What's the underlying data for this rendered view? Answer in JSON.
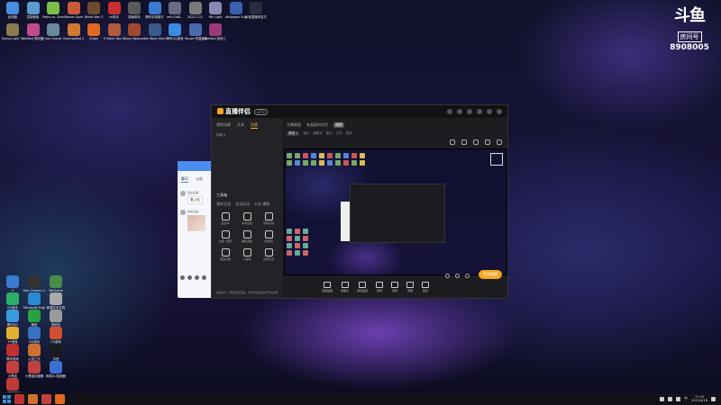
{
  "desktop": {
    "icons_top": [
      {
        "label": "此电脑",
        "color": "#4a8de0"
      },
      {
        "label": "控制面板",
        "color": "#5a9ad0"
      },
      {
        "label": "Paths vs. Zombies",
        "color": "#7bbf4a"
      },
      {
        "label": "Mouse Gaze",
        "color": "#c85a3a"
      },
      {
        "label": "World War Z",
        "color": "#6b4a30"
      },
      {
        "label": "vn助手",
        "color": "#c83030"
      },
      {
        "label": "原画助手",
        "color": "#5a5a5a"
      },
      {
        "label": "腾讯手游助手",
        "color": "#3a7ad0"
      },
      {
        "label": "neil-GoBi...",
        "color": "#6a6a80"
      },
      {
        "label": "2022.2.22",
        "color": "#7a7a7a"
      },
      {
        "label": "Wa Light",
        "color": "#8a8ab0"
      },
      {
        "label": "Wallpaper Engine",
        "color": "#3a60b0"
      },
      {
        "label": "抖音直播伴侣平台",
        "color": "#2a2a40"
      }
    ],
    "icons_row2": [
      {
        "label": "Dying Light The Follo...",
        "color": "#8a7a50"
      },
      {
        "label": "WeMod 修改器游戏工具",
        "color": "#c04a8a"
      },
      {
        "label": "Iron Gravel",
        "color": "#6a8a9a"
      },
      {
        "label": "Overcooked 2",
        "color": "#d07a30"
      },
      {
        "label": "Origin",
        "color": "#e06a20"
      },
      {
        "label": "It Takes Two Fr...",
        "color": "#b05a40"
      },
      {
        "label": "Ivory Beacon",
        "color": "#a04a30"
      },
      {
        "label": "We Were Here Toge...",
        "color": "#3a5a8a"
      },
      {
        "label": "腾讯QQ游戏",
        "color": "#3a8ae0"
      },
      {
        "label": "Mouse 有直播伴侣",
        "color": "#4a6ab0"
      },
      {
        "label": "WeMod 游戏工具",
        "color": "#9a3a7a"
      }
    ],
    "icons_left": [
      {
        "label": "V",
        "color": "#3a7ad0"
      },
      {
        "label": "Epic Games Launcher",
        "color": "#333333"
      },
      {
        "label": "WeGame",
        "color": "#4a8a4a"
      },
      {
        "label": "QQ音乐",
        "color": "#2ab06a"
      },
      {
        "label": "Microsoft Edge",
        "color": "#2a8ad0"
      },
      {
        "label": "新建文本文档",
        "color": "#aaaaaa"
      },
      {
        "label": "腾讯QQ",
        "color": "#3a9ae0"
      },
      {
        "label": "微信",
        "color": "#2aa040"
      },
      {
        "label": "回收站",
        "color": "#9a9a9a"
      },
      {
        "label": "YY语音",
        "color": "#e0b030"
      },
      {
        "label": "QQ游戏",
        "color": "#3a70c0"
      },
      {
        "label": "CS游戏",
        "color": "#d05030"
      },
      {
        "label": "腾讯游戏",
        "color": "#c03030"
      },
      {
        "label": "火炬之光",
        "color": "#d07030"
      },
      {
        "label": "抖音",
        "color": "#1a1a1a"
      },
      {
        "label": "小黑盒",
        "color": "#c04040"
      },
      {
        "label": "小黑盒加速器",
        "color": "#c04040"
      },
      {
        "label": "网易UU加速器",
        "color": "#3a70d0"
      },
      {
        "label": "小黑盒游戏",
        "color": "#c03a3a"
      }
    ]
  },
  "logo_badge": {
    "mark": "斗鱼",
    "sub": "房间号",
    "room_number": "8908005"
  },
  "chat": {
    "tabs": [
      "聊天",
      "公告"
    ],
    "messages": [
      {
        "name": "某某主播",
        "text": "要上线"
      },
      {
        "name": "某某主播",
        "text": ""
      }
    ]
  },
  "app": {
    "brand": "直播伴侣",
    "version": "v7.0",
    "left_tabs": [
      "我的场景",
      "开关",
      "场景"
    ],
    "scene_row": "场景 1",
    "tools_title": "工具箱",
    "tool_groups": [
      "我的互动",
      "互动玩法",
      "公告·通知"
    ],
    "tools": [
      {
        "label": "连麦PK",
        "icon": "link-icon"
      },
      {
        "label": "房间设置",
        "icon": "home-icon"
      },
      {
        "label": "营销活动",
        "icon": "chart-icon"
      },
      {
        "label": "主播一起玩",
        "icon": "users-icon"
      },
      {
        "label": "福利宝箱",
        "icon": "gift-icon"
      },
      {
        "label": "粉丝团",
        "icon": "cube-icon"
      },
      {
        "label": "更多功能",
        "icon": "plus-icon"
      },
      {
        "label": "小游戏",
        "icon": "game-icon"
      },
      {
        "label": "互动玩法",
        "icon": "puzzle-icon"
      }
    ],
    "notice": "主播提示：绿色健康直播，涉黄涉政违规将严肃处理"
  },
  "preview_header": {
    "tabs": [
      "主播画面",
      "有画面的伴侣",
      "横屏"
    ],
    "subtabs": [
      "屏幕 1",
      "窗口",
      "摄像头",
      "图片",
      "文字",
      "更多"
    ]
  },
  "controls": [
    {
      "label": "直播画面",
      "icon": "screen-icon"
    },
    {
      "label": "摄像头",
      "icon": "camera-icon"
    },
    {
      "label": "游戏画面",
      "icon": "gamepad-icon"
    },
    {
      "label": "投屏",
      "icon": "cast-icon"
    },
    {
      "label": "视频",
      "icon": "video-icon"
    },
    {
      "label": "音频",
      "icon": "audio-icon"
    },
    {
      "label": "更多",
      "icon": "more-icon"
    }
  ],
  "start_button": "开始直播",
  "taskbar": {
    "apps": [
      "#c03030",
      "#d07030",
      "#c04040",
      "#e06a20"
    ],
    "time": "17:40",
    "date": "2022/4/18",
    "ime": "中"
  }
}
